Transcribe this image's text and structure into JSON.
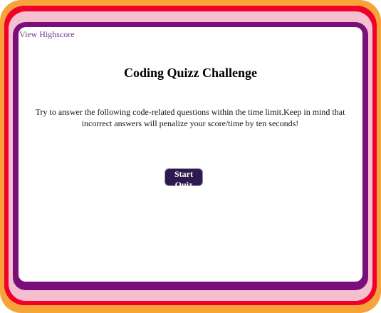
{
  "header": {
    "highscore_link": "View Highscore"
  },
  "main": {
    "title": "Coding Quizz Challenge",
    "intro": "Try to answer the following code-related questions within the time limit.Keep in mind that incorrect answers will penalize your score/time by ten seconds!",
    "start_button_label": "Start Quiz"
  },
  "colors": {
    "outer_border": "#f8a33a",
    "red_border": "#f0002a",
    "pink_border": "#f6bfcf",
    "purple_border": "#7a0f7b",
    "button_bg": "#2e1a4d",
    "link": "#6b3d8f"
  }
}
